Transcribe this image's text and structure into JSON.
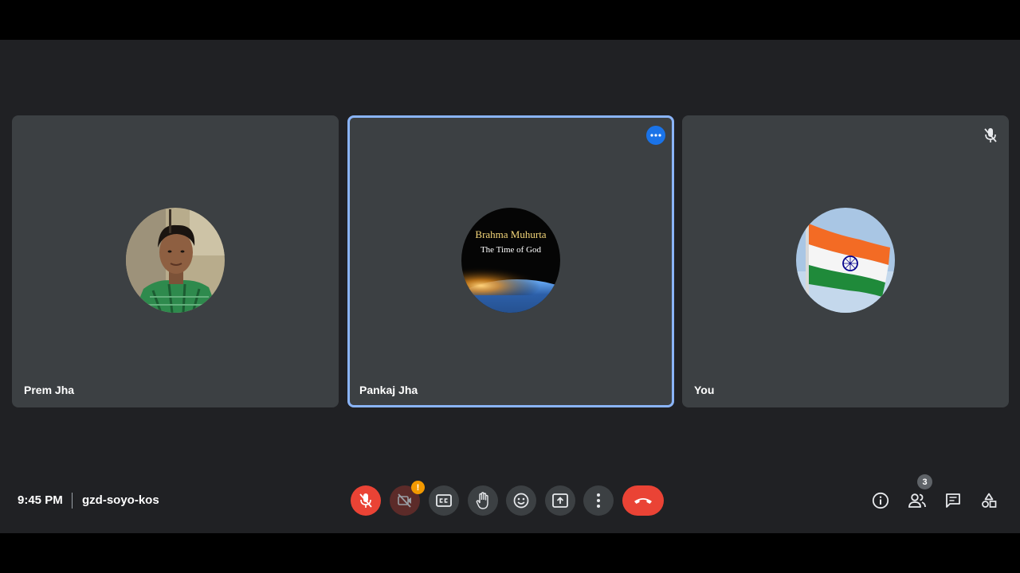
{
  "participants": [
    {
      "name": "Prem Jha",
      "avatar": "person-photo"
    },
    {
      "name": "Pankaj Jha",
      "avatar": "earth-sunrise-logo",
      "avatar_text_line1": "Brahma Muhurta",
      "avatar_text_line2": "The Time of God",
      "active_speaker": true
    },
    {
      "name": "You",
      "avatar": "india-flag",
      "muted": true
    }
  ],
  "footer": {
    "time": "9:45 PM",
    "meeting_code": "gzd-soyo-kos",
    "camera_alert": "!",
    "people_count": "3"
  },
  "controls": [
    "mic-off-icon",
    "camera-off-icon",
    "captions-icon",
    "raise-hand-icon",
    "emoji-icon",
    "present-icon",
    "more-vert-icon",
    "hang-up-icon"
  ],
  "side_controls": [
    "info-icon",
    "people-icon",
    "chat-icon",
    "activities-icon"
  ],
  "colors": {
    "background": "#202124",
    "tile": "#3c4043",
    "active_border": "#8ab4f8",
    "danger": "#ea4335",
    "accent": "#1a73e8",
    "warning": "#f29900"
  }
}
